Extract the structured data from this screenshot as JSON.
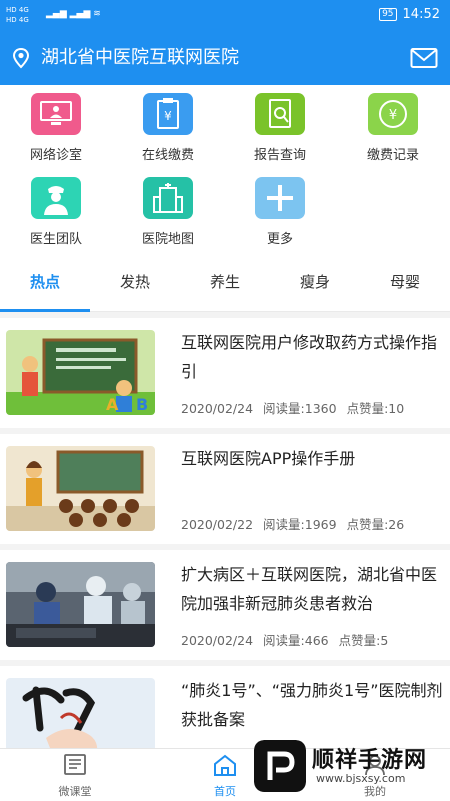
{
  "statusbar": {
    "left_top": "HD 4G",
    "left_bottom": "HD 4G",
    "battery": "95",
    "time": "14:52"
  },
  "header": {
    "title": "湖北省中医院互联网医院"
  },
  "services": [
    {
      "label": "网络诊室",
      "color": "#f05a8c",
      "icon": "monitor-doctor-icon"
    },
    {
      "label": "在线缴费",
      "color": "#3a9cf0",
      "icon": "payment-clipboard-icon"
    },
    {
      "label": "报告查询",
      "color": "#7ac32a",
      "icon": "report-search-icon"
    },
    {
      "label": "缴费记录",
      "color": "#8bd44a",
      "icon": "yuan-coin-icon"
    },
    {
      "label": "医生团队",
      "color": "#2dd4b4",
      "icon": "nurse-icon"
    },
    {
      "label": "医院地图",
      "color": "#25c1a6",
      "icon": "hospital-building-icon"
    },
    {
      "label": "更多",
      "color": "#7cc4f0",
      "icon": "plus-icon"
    }
  ],
  "tabs": [
    "热点",
    "发热",
    "养生",
    "瘦身",
    "母婴"
  ],
  "active_tab": 0,
  "articles": [
    {
      "title": "互联网医院用户修改取药方式操作指引",
      "date": "2020/02/24",
      "reads": "阅读量:1360",
      "likes": "点赞量:10"
    },
    {
      "title": "互联网医院APP操作手册",
      "date": "2020/02/22",
      "reads": "阅读量:1969",
      "likes": "点赞量:26"
    },
    {
      "title": "扩大病区＋互联网医院，湖北省中医院加强非新冠肺炎患者救治",
      "date": "2020/02/24",
      "reads": "阅读量:466",
      "likes": "点赞量:5"
    },
    {
      "title": "“肺炎1号”、“强力肺炎1号”医院制剂获批备案",
      "date": "",
      "reads": "",
      "likes": ""
    }
  ],
  "bottom_nav": [
    {
      "label": "微课堂",
      "icon": "book-icon"
    },
    {
      "label": "首页",
      "icon": "home-icon"
    },
    {
      "label": "我的",
      "icon": "user-icon"
    }
  ],
  "watermark": {
    "text": "顺祥手游网",
    "url": "www.bjsxsy.com"
  }
}
